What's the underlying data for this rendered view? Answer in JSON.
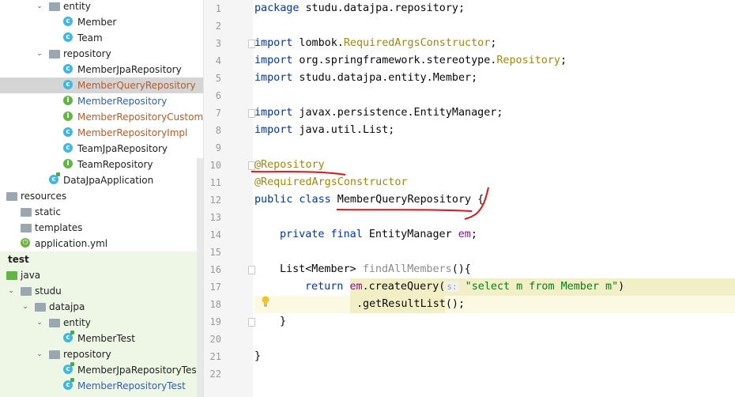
{
  "project_tree": {
    "rows": [
      {
        "label": "entity",
        "icon": "folder-icon"
      },
      {
        "label": "Member",
        "icon": "class-icon"
      },
      {
        "label": "Team",
        "icon": "class-icon"
      },
      {
        "label": "repository",
        "icon": "folder-icon"
      },
      {
        "label": "MemberJpaRepository",
        "icon": "class-icon"
      },
      {
        "label": "MemberQueryRepository",
        "icon": "class-icon",
        "selected": true
      },
      {
        "label": "MemberRepository",
        "icon": "interface-icon"
      },
      {
        "label": "MemberRepositoryCustom",
        "icon": "interface-icon"
      },
      {
        "label": "MemberRepositoryImpl",
        "icon": "class-icon"
      },
      {
        "label": "TeamJpaRepository",
        "icon": "class-icon"
      },
      {
        "label": "TeamRepository",
        "icon": "interface-icon"
      },
      {
        "label": "DataJpaApplication",
        "icon": "class-run-icon"
      },
      {
        "label": "resources",
        "icon": "resources-folder-icon"
      },
      {
        "label": "static",
        "icon": "folder-icon"
      },
      {
        "label": "templates",
        "icon": "folder-icon"
      },
      {
        "label": "application.yml",
        "icon": "spring-yml-icon"
      },
      {
        "label": "test",
        "icon": "none"
      },
      {
        "label": "java",
        "icon": "test-folder-icon"
      },
      {
        "label": "studu",
        "icon": "folder-icon"
      },
      {
        "label": "datajpa",
        "icon": "folder-icon"
      },
      {
        "label": "entity",
        "icon": "folder-icon"
      },
      {
        "label": "MemberTest",
        "icon": "test-class-icon"
      },
      {
        "label": "repository",
        "icon": "folder-icon"
      },
      {
        "label": "MemberJpaRepositoryTest",
        "icon": "test-class-icon"
      },
      {
        "label": "MemberRepositoryTest",
        "icon": "test-class-icon"
      }
    ]
  },
  "editor": {
    "line_numbers": [
      "1",
      "2",
      "3",
      "4",
      "5",
      "6",
      "7",
      "8",
      "9",
      "10",
      "11",
      "12",
      "13",
      "14",
      "15",
      "16",
      "17",
      "18",
      "19",
      "20",
      "21",
      "22"
    ],
    "code": {
      "l1_kw": "package",
      "l1_rest": " studu.datajpa.repository;",
      "l3_kw": "import",
      "l3_pkg": " lombok.",
      "l3_cls": "RequiredArgsConstructor",
      "l3_end": ";",
      "l4_kw": "import",
      "l4_pkg": " org.springframework.stereotype.",
      "l4_cls": "Repository",
      "l4_end": ";",
      "l5_kw": "import",
      "l5_rest": " studu.datajpa.entity.Member;",
      "l7_kw": "import",
      "l7_rest": " javax.persistence.EntityManager;",
      "l8_kw": "import",
      "l8_rest": " java.util.List;",
      "l10": "@Repository",
      "l11": "@RequiredArgsConstructor",
      "l12_kw": "public class",
      "l12_name": " MemberQueryRepository",
      "l12_end": " {",
      "l14_kw": "private final",
      "l14_type": " EntityManager ",
      "l14_field": "em",
      "l14_end": ";",
      "l16_type": "List<Member> ",
      "l16_method": "findAllMembers",
      "l16_end": "(){",
      "l17_kw": "return",
      "l17_sp": " ",
      "l17_field": "em",
      "l17_call": ".createQuery(",
      "l17_hint": "s:",
      "l17_str": " \"select m from Member m\"",
      "l17_end": ")",
      "l18": ".getResultList();",
      "l19": "}",
      "l21": "}"
    }
  },
  "colors": {
    "keyword": "#0033b3",
    "annotation": "#9e880d",
    "field": "#871094",
    "string": "#067d17",
    "red_markup": "#e0131a"
  }
}
